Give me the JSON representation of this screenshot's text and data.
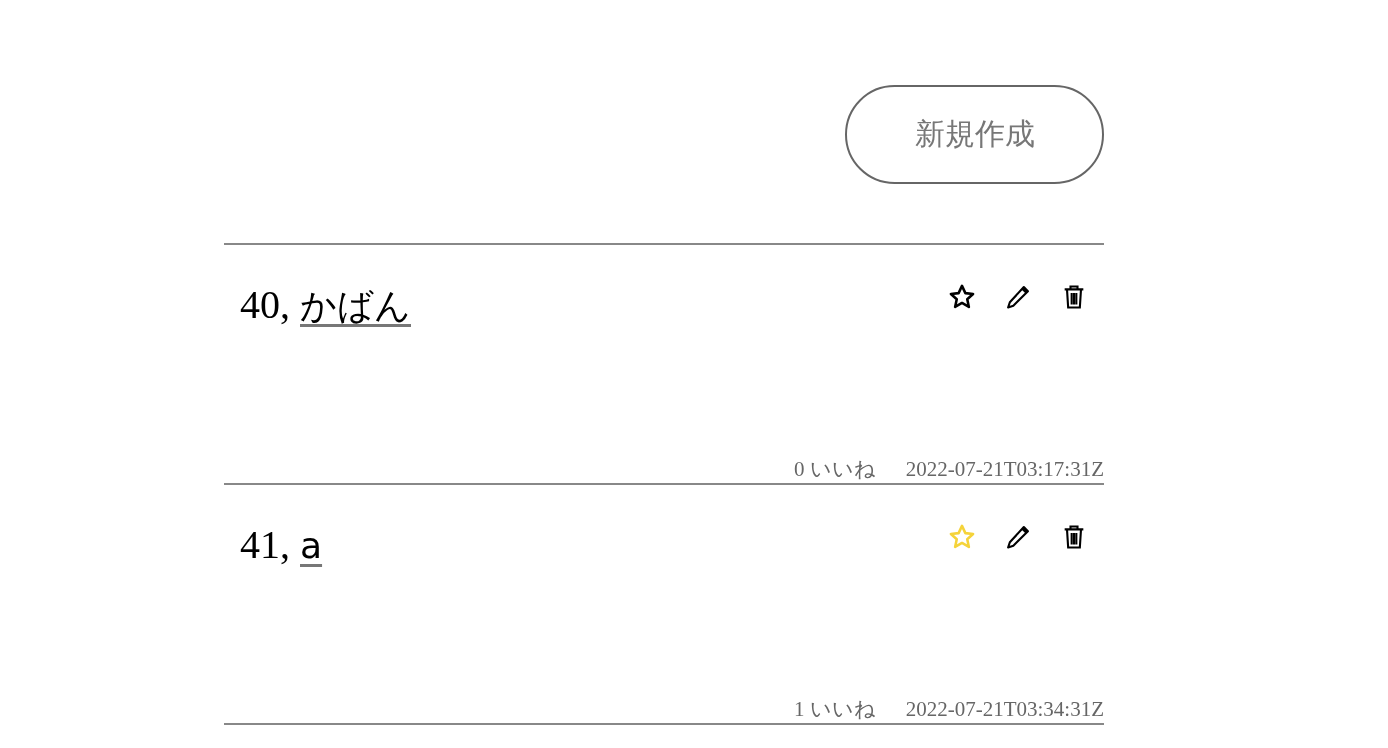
{
  "new_button": {
    "label": "新規作成"
  },
  "posts": [
    {
      "number": "40,",
      "title": "かばん",
      "liked": false,
      "likes": "0 いいね",
      "timestamp": "2022-07-21T03:17:31Z"
    },
    {
      "number": "41,",
      "title": "a",
      "liked": true,
      "likes": "1 いいね",
      "timestamp": "2022-07-21T03:34:31Z"
    }
  ]
}
